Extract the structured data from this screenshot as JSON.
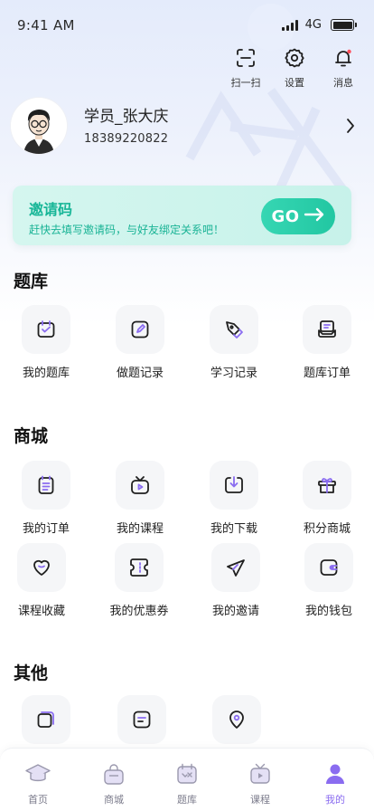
{
  "status_bar": {
    "time": "9:41 AM",
    "network": "4G"
  },
  "top_actions": [
    {
      "label": "扫一扫",
      "icon": "scan-icon"
    },
    {
      "label": "设置",
      "icon": "gear-icon"
    },
    {
      "label": "消息",
      "icon": "bell-icon"
    }
  ],
  "profile": {
    "name": "学员_张大庆",
    "phone": "18389220822",
    "avatar": "avatar-cartoon-icon"
  },
  "invite": {
    "title": "邀请码",
    "subtitle": "赶快去填写邀请码，与好友绑定关系吧！",
    "button": "GO"
  },
  "sections": {
    "question_bank": {
      "title": "题库",
      "items": [
        {
          "label": "我的题库",
          "icon": "question-bank-icon"
        },
        {
          "label": "做题记录",
          "icon": "edit-record-icon"
        },
        {
          "label": "学习记录",
          "icon": "pen-nib-icon"
        },
        {
          "label": "题库订单",
          "icon": "order-icon"
        }
      ]
    },
    "mall": {
      "title": "商城",
      "items": [
        {
          "label": "我的订单",
          "icon": "order-list-icon"
        },
        {
          "label": "我的课程",
          "icon": "tv-play-icon"
        },
        {
          "label": "我的下载",
          "icon": "download-icon"
        },
        {
          "label": "积分商城",
          "icon": "gift-icon"
        },
        {
          "label": "课程收藏",
          "icon": "heart-icon"
        },
        {
          "label": "我的优惠券",
          "icon": "coupon-icon"
        },
        {
          "label": "我的邀请",
          "icon": "send-icon"
        },
        {
          "label": "我的钱包",
          "icon": "wallet-icon"
        }
      ]
    },
    "other": {
      "title": "其他",
      "items": [
        {
          "icon": "square-icon"
        },
        {
          "icon": "document-icon"
        },
        {
          "icon": "location-icon"
        }
      ]
    }
  },
  "tabbar": [
    {
      "label": "首页",
      "icon": "graduation-cap-icon"
    },
    {
      "label": "商城",
      "icon": "shopping-bag-icon"
    },
    {
      "label": "题库",
      "icon": "question-bank-tab-icon"
    },
    {
      "label": "课程",
      "icon": "course-tv-icon"
    },
    {
      "label": "我的",
      "icon": "user-icon",
      "active": true
    }
  ],
  "colors": {
    "accent": "#8a6cf0",
    "invite_green": "#17b697",
    "go_button": "#22c7a2",
    "icon_dark": "#1f1f1f"
  }
}
